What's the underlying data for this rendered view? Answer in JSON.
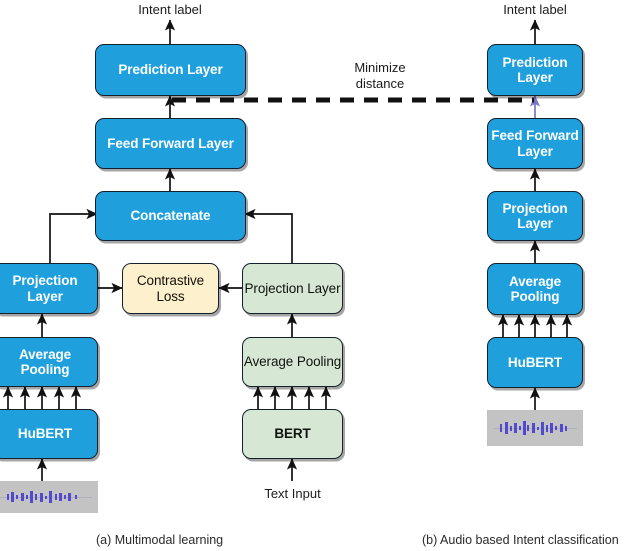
{
  "figure": {
    "panels": [
      {
        "id": "a",
        "caption": "(a) Multimodal learning",
        "output_label": "Intent label",
        "text_input_label": "Text Input",
        "nodes": {
          "prediction_layer": "Prediction Layer",
          "feed_forward_layer": "Feed Forward Layer",
          "concatenate": "Concatenate",
          "audio_projection_layer": "Projection Layer",
          "contrastive_loss": "Contrastive Loss",
          "text_projection_layer": "Projection Layer",
          "audio_average_pooling": "Average Pooling",
          "text_average_pooling": "Average Pooling",
          "hubert": "HuBERT",
          "bert": "BERT"
        }
      },
      {
        "id": "b",
        "caption": "(b) Audio based Intent classification",
        "output_label": "Intent label",
        "nodes": {
          "prediction_layer": "Prediction Layer",
          "feed_forward_layer": "Feed Forward Layer",
          "projection_layer": "Projection Layer",
          "average_pooling": "Average Pooling",
          "hubert": "HuBERT"
        }
      }
    ],
    "connector_label": "Minimize distance",
    "colors": {
      "audio_blue": "#1fa0dd",
      "text_green": "#d6e8d3",
      "loss_yellow": "#fdf1cd",
      "stroke_dark": "#14202b",
      "waveform_gray": "#c3c3c3",
      "waveform_purple": "#4a3fcf",
      "minimize_arrow_purple": "#7b76c4"
    }
  }
}
